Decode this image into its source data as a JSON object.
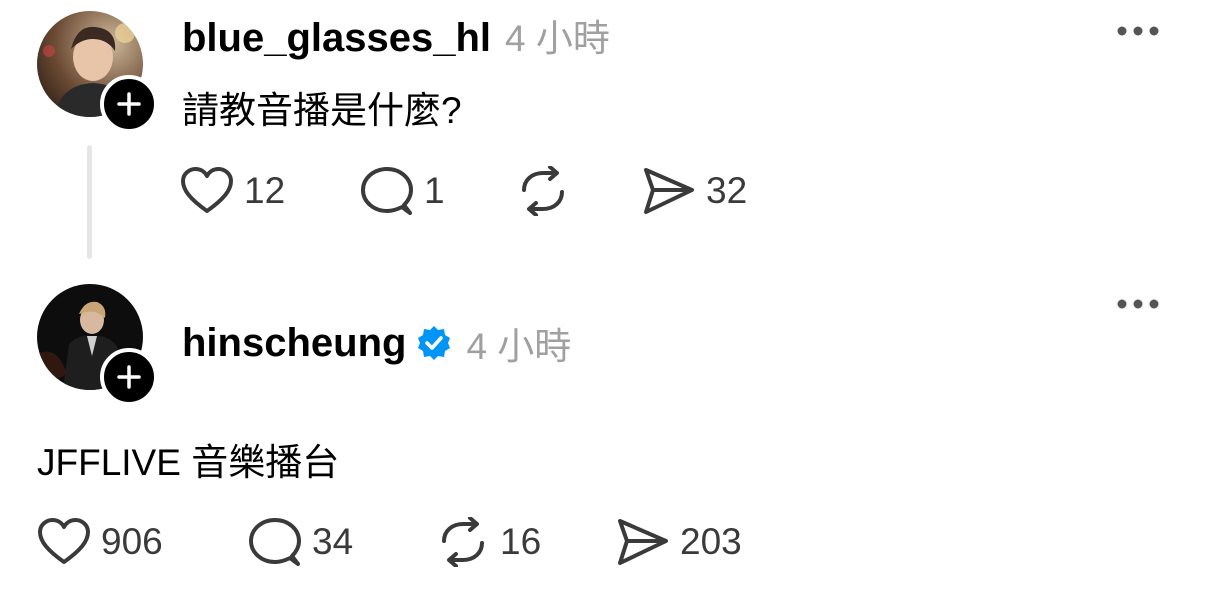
{
  "posts": [
    {
      "username": "blue_glasses_hl",
      "time": "4 小時",
      "text": "請教音播是什麼?",
      "verified": false,
      "counts": {
        "like": "12",
        "reply": "1",
        "repost": "",
        "share": "32"
      }
    },
    {
      "username": "hinscheung",
      "time": "4 小時",
      "text": "JFFLIVE 音樂播台",
      "verified": true,
      "counts": {
        "like": "906",
        "reply": "34",
        "repost": "16",
        "share": "203"
      }
    }
  ],
  "icons": {
    "like": "heart-icon",
    "reply": "comment-icon",
    "repost": "repost-icon",
    "share": "share-icon",
    "more": "more-icon",
    "follow": "plus-icon",
    "verified": "verified-badge-icon"
  },
  "colors": {
    "verified": "#0095f6",
    "muted": "#a0a0a0",
    "count": "#3a3a3a"
  }
}
